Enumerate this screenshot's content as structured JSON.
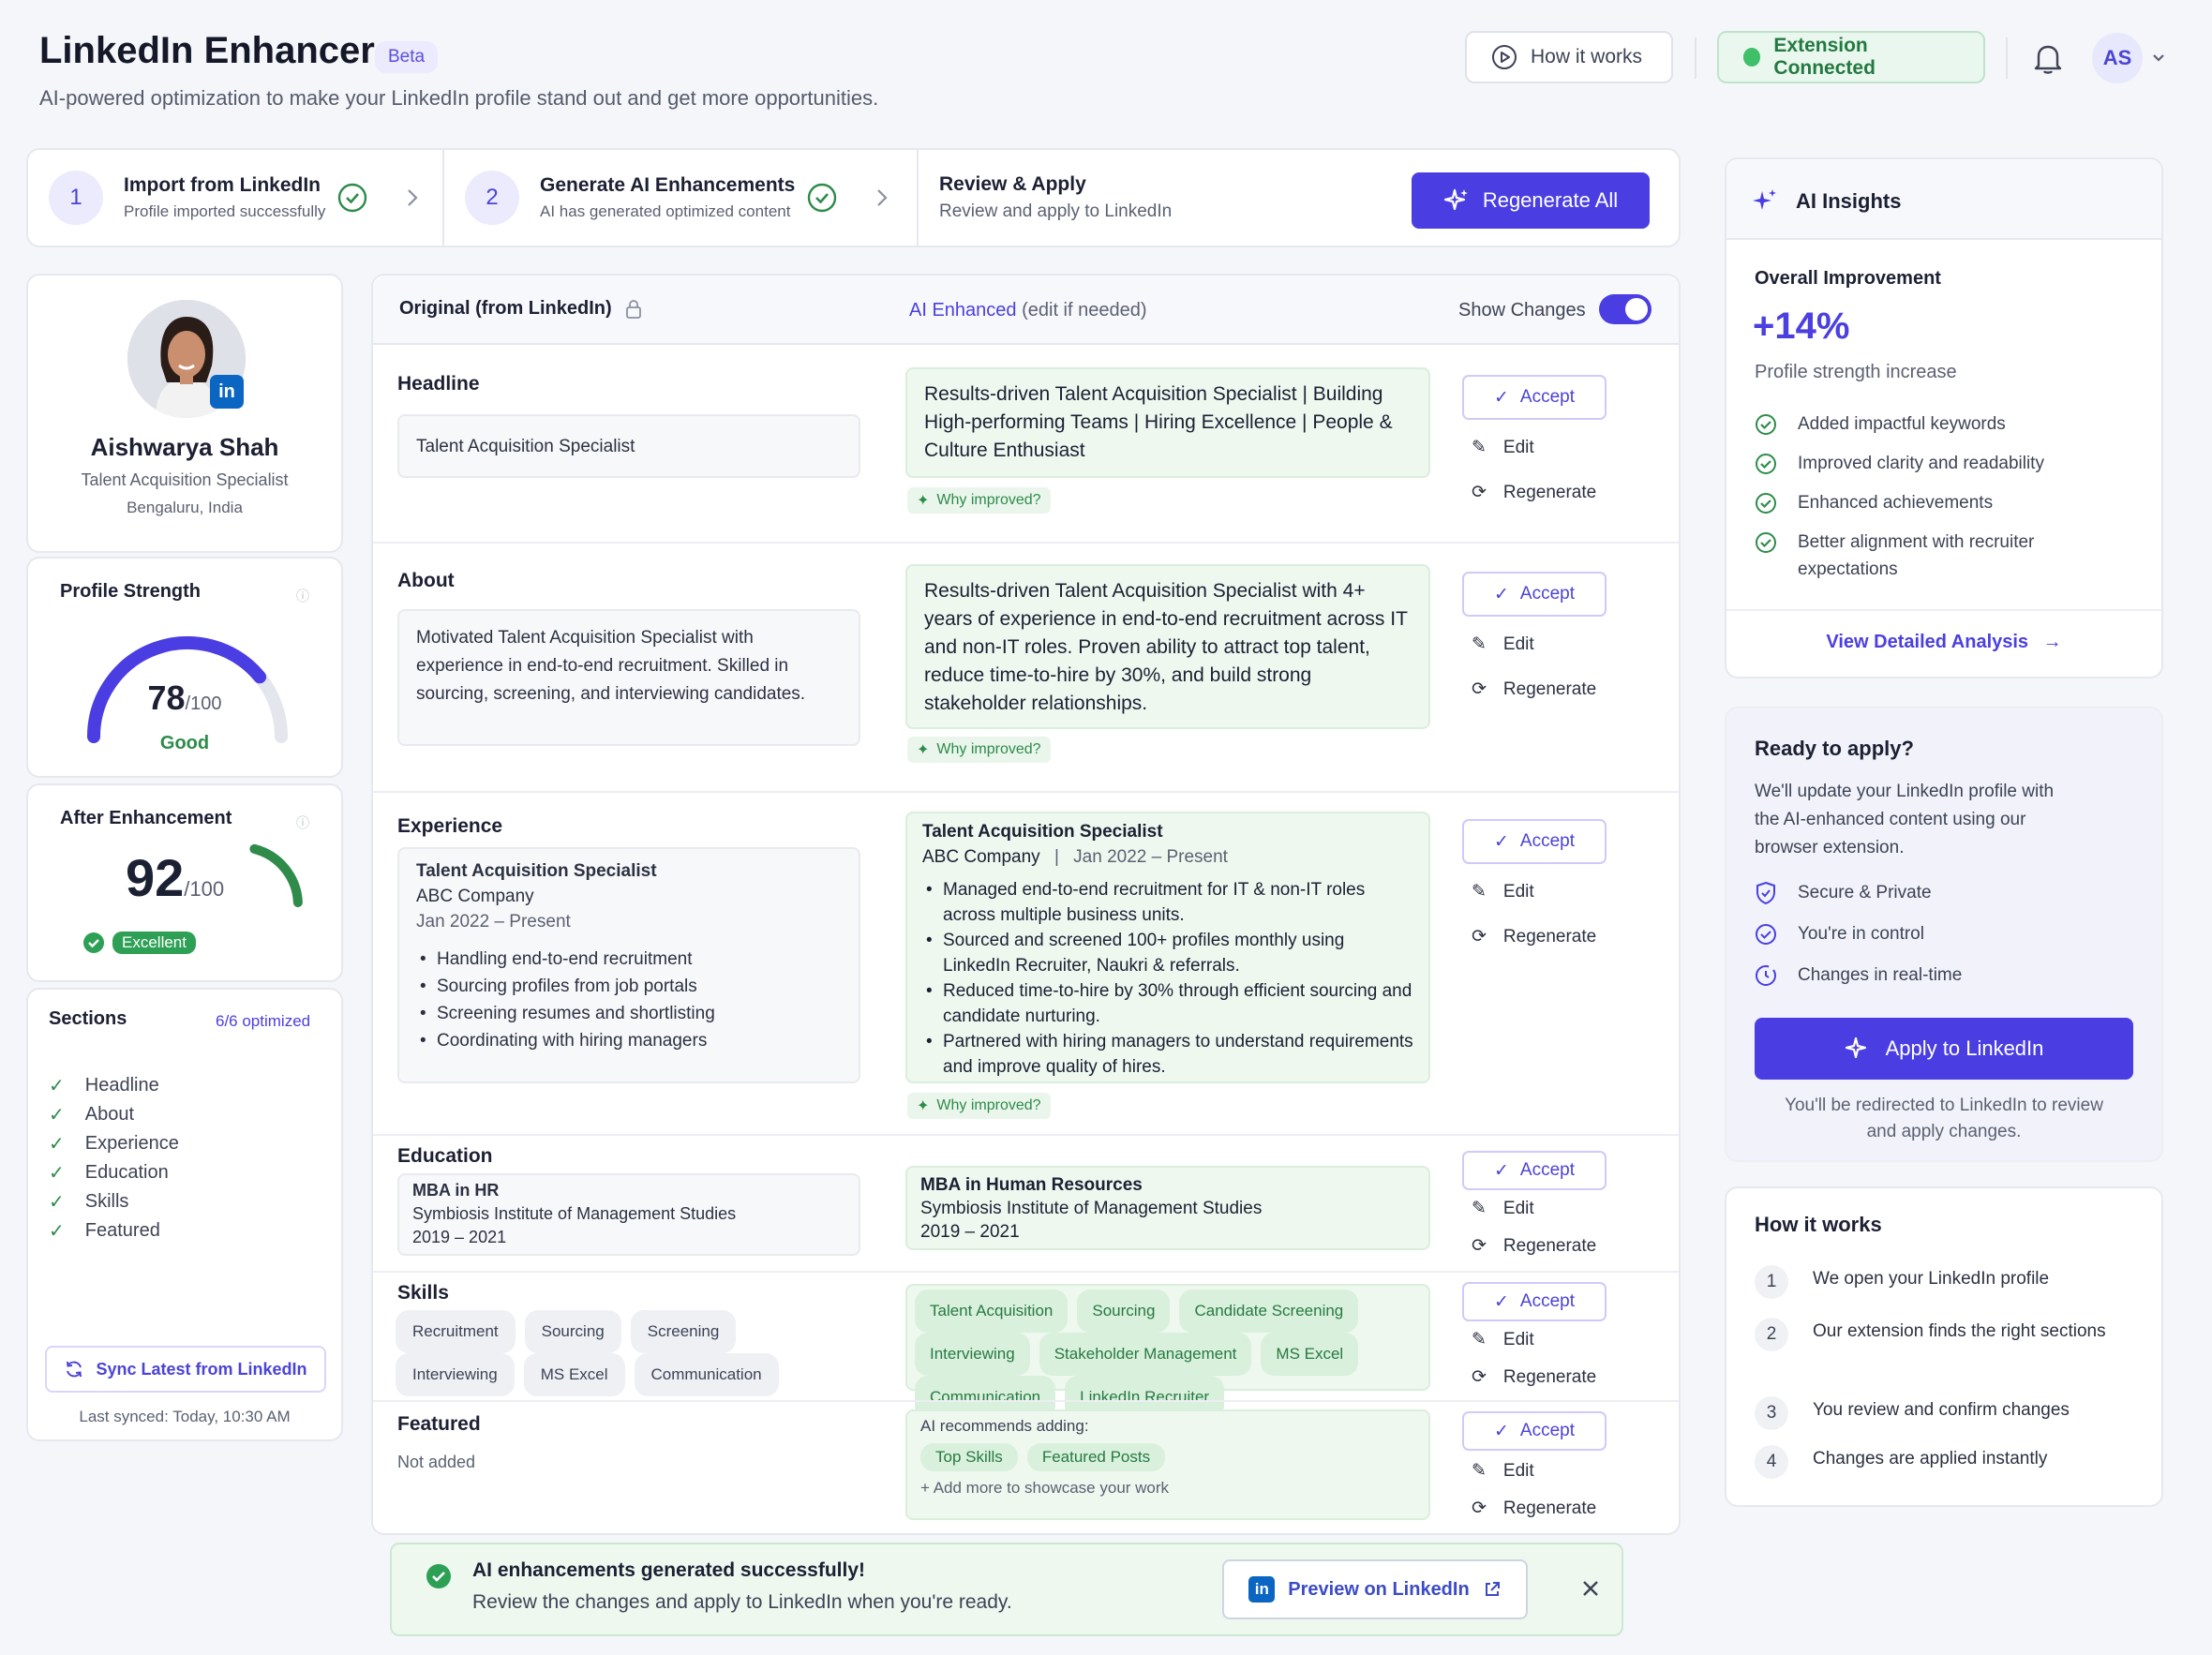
{
  "header": {
    "title": "LinkedIn Enhancer",
    "beta": "Beta",
    "subtitle": "AI-powered optimization to make your LinkedIn profile stand out and get more opportunities.",
    "how_button": "How it works",
    "extension_status": "Extension Connected",
    "avatar_initials": "AS"
  },
  "steps": [
    {
      "num": "1",
      "title": "Import from LinkedIn",
      "sub": "Profile imported successfully"
    },
    {
      "num": "2",
      "title": "Generate AI Enhancements",
      "sub": "AI has generated optimized content"
    },
    {
      "num": "",
      "title": "Review & Apply",
      "sub": "Review and apply to LinkedIn"
    }
  ],
  "regenerate_all": "Regenerate All",
  "profile": {
    "name": "Aishwarya Shah",
    "role": "Talent Acquisition Specialist",
    "location": "Bengaluru, India"
  },
  "strength": {
    "title": "Profile Strength",
    "score": "78",
    "max": "/100",
    "label": "Good",
    "value": 78
  },
  "after": {
    "title": "After Enhancement",
    "score": "92",
    "max": "/100",
    "label": "Excellent",
    "value": 92
  },
  "sections": {
    "title": "Sections",
    "status": "6/6 optimized",
    "items": [
      "Headline",
      "About",
      "Experience",
      "Education",
      "Skills",
      "Featured"
    ],
    "sync_button": "Sync Latest from LinkedIn",
    "last_synced": "Last synced: Today, 10:30 AM"
  },
  "columns": {
    "original": "Original (from LinkedIn)",
    "enhanced": "AI Enhanced",
    "enhanced_hint": "(edit if needed)",
    "show_changes": "Show Changes"
  },
  "actions": {
    "accept": "Accept",
    "edit": "Edit",
    "regenerate": "Regenerate",
    "why": "Why improved?"
  },
  "headline": {
    "title": "Headline",
    "original": "Talent Acquisition Specialist",
    "enhanced": "Results-driven Talent Acquisition Specialist | Building High-performing Teams | Hiring Excellence | People & Culture Enthusiast"
  },
  "about": {
    "title": "About",
    "original": "Motivated Talent Acquisition Specialist with experience in end-to-end recruitment. Skilled in sourcing, screening, and interviewing candidates.",
    "enhanced": "Results-driven Talent Acquisition Specialist with 4+ years of experience in end-to-end recruitment across IT and non-IT roles. Proven ability to attract top talent, reduce time-to-hire by 30%, and build strong stakeholder relationships."
  },
  "experience": {
    "title": "Experience",
    "original": {
      "role": "Talent Acquisition Specialist",
      "company": "ABC Company",
      "dates": "Jan 2022 – Present",
      "bullets": [
        "Handling end-to-end recruitment",
        "Sourcing profiles from job portals",
        "Screening resumes and shortlisting",
        "Coordinating with hiring managers"
      ]
    },
    "enhanced": {
      "role": "Talent Acquisition Specialist",
      "company": "ABC Company",
      "sep": "|",
      "dates": "Jan 2022 – Present",
      "bullets": [
        "Managed end-to-end recruitment for IT & non-IT roles across multiple business units.",
        "Sourced and screened 100+ profiles monthly using LinkedIn Recruiter, Naukri & referrals.",
        "Reduced time-to-hire by 30% through efficient sourcing and candidate nurturing.",
        "Partnered with hiring managers to understand requirements and improve quality of hires."
      ]
    }
  },
  "education": {
    "title": "Education",
    "original": {
      "degree": "MBA in HR",
      "school": "Symbiosis Institute of Management Studies",
      "years": "2019 – 2021"
    },
    "enhanced": {
      "degree": "MBA in Human Resources",
      "school": "Symbiosis Institute of Management Studies",
      "years": "2019 – 2021"
    }
  },
  "skills": {
    "title": "Skills",
    "original": [
      "Recruitment",
      "Sourcing",
      "Screening",
      "Interviewing",
      "MS Excel",
      "Communication"
    ],
    "enhanced": [
      "Talent Acquisition",
      "Sourcing",
      "Candidate Screening",
      "Interviewing",
      "Stakeholder Management",
      "MS Excel",
      "Communication",
      "LinkedIn Recruiter"
    ]
  },
  "featured": {
    "title": "Featured",
    "original": "Not added",
    "recommend": "AI recommends adding:",
    "chips": [
      "Top Skills",
      "Featured Posts"
    ],
    "add_more": "+ Add more to showcase your work"
  },
  "toast": {
    "title": "AI enhancements generated successfully!",
    "sub": "Review the changes and apply to LinkedIn when you're ready.",
    "preview": "Preview on LinkedIn"
  },
  "insights": {
    "title": "AI Insights",
    "overall": "Overall Improvement",
    "delta": "+14%",
    "delta_label": "Profile strength increase",
    "items": [
      "Added impactful keywords",
      "Improved clarity and readability",
      "Enhanced achievements",
      "Better alignment with recruiter expectations"
    ],
    "link": "View Detailed Analysis"
  },
  "ready": {
    "title": "Ready to apply?",
    "body": "We'll update your LinkedIn profile with the AI-enhanced content using our browser extension.",
    "points": [
      "Secure & Private",
      "You're in control",
      "Changes in real-time"
    ],
    "button": "Apply to LinkedIn",
    "note": "You'll be redirected to LinkedIn to review and apply changes."
  },
  "how": {
    "title": "How it works",
    "steps": [
      "We open your LinkedIn profile",
      "Our extension finds the right sections",
      "You review and confirm changes",
      "Changes are applied instantly"
    ]
  },
  "colors": {
    "accent": "#4a3ee3",
    "success": "#2e8b4a",
    "linkedin": "#0a66c2"
  },
  "icons": [
    "play-icon",
    "bell-icon",
    "chevron-down-icon",
    "check-circle-icon",
    "chevron-right-icon",
    "sparkle-icon",
    "lock-icon",
    "check-icon",
    "pencil-icon",
    "refresh-icon",
    "shield-icon",
    "external-link-icon",
    "close-icon",
    "arrow-right-icon",
    "clock-icon"
  ]
}
